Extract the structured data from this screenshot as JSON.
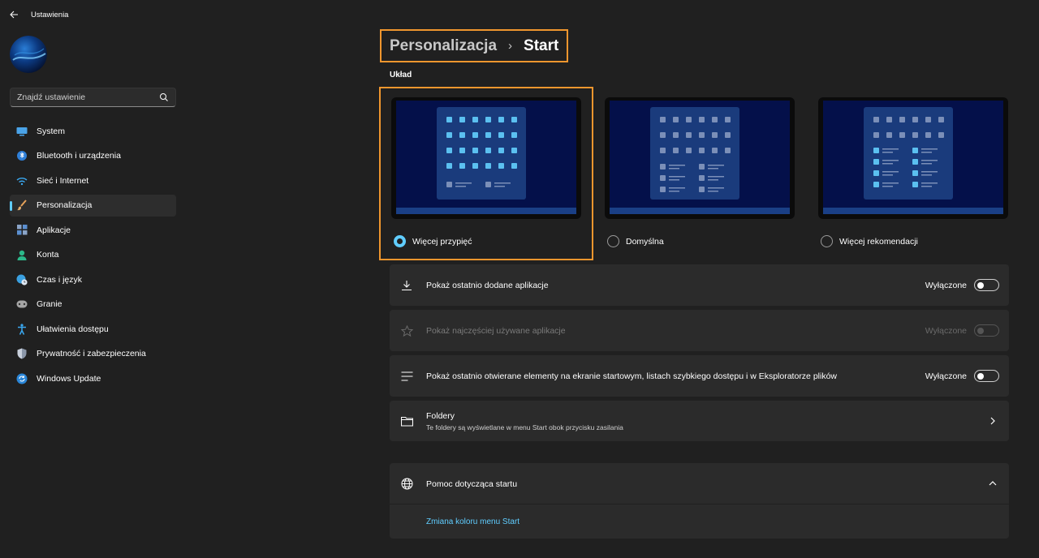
{
  "app": {
    "title": "Ustawienia"
  },
  "search": {
    "placeholder": "Znajdź ustawienie"
  },
  "sidebar": {
    "items": [
      {
        "label": "System",
        "icon": "system-icon"
      },
      {
        "label": "Bluetooth i urządzenia",
        "icon": "bluetooth-icon"
      },
      {
        "label": "Sieć i Internet",
        "icon": "wifi-icon"
      },
      {
        "label": "Personalizacja",
        "icon": "brush-icon",
        "active": true
      },
      {
        "label": "Aplikacje",
        "icon": "apps-icon"
      },
      {
        "label": "Konta",
        "icon": "account-icon"
      },
      {
        "label": "Czas i język",
        "icon": "globe-clock-icon"
      },
      {
        "label": "Granie",
        "icon": "gamepad-icon"
      },
      {
        "label": "Ułatwienia dostępu",
        "icon": "accessibility-icon"
      },
      {
        "label": "Prywatność i zabezpieczenia",
        "icon": "shield-icon"
      },
      {
        "label": "Windows Update",
        "icon": "update-icon"
      }
    ]
  },
  "header": {
    "parent": "Personalizacja",
    "separator": ">",
    "current": "Start"
  },
  "layout_section": {
    "label": "Układ",
    "options": [
      {
        "label": "Więcej przypięć",
        "checked": true
      },
      {
        "label": "Domyślna",
        "checked": false
      },
      {
        "label": "Więcej rekomendacji",
        "checked": false
      }
    ]
  },
  "settings": {
    "recent_apps": {
      "label": "Pokaż ostatnio dodane aplikacje",
      "state": "Wyłączone",
      "on": false,
      "disabled": false
    },
    "most_used": {
      "label": "Pokaż najczęściej używane aplikacje",
      "state": "Wyłączone",
      "on": false,
      "disabled": true
    },
    "recent_items": {
      "label": "Pokaż ostatnio otwierane elementy na ekranie startowym, listach szybkiego dostępu i w Eksploratorze plików",
      "state": "Wyłączone",
      "on": false,
      "disabled": false
    },
    "folders": {
      "label": "Foldery",
      "description": "Te foldery są wyświetlane w menu Start obok przycisku zasilania"
    }
  },
  "help": {
    "title": "Pomoc dotycząca startu",
    "link": "Zmiana koloru menu Start"
  },
  "colors": {
    "accent": "#60cdff",
    "highlight": "#f0962e",
    "background": "#202020",
    "card": "#2b2b2b"
  }
}
